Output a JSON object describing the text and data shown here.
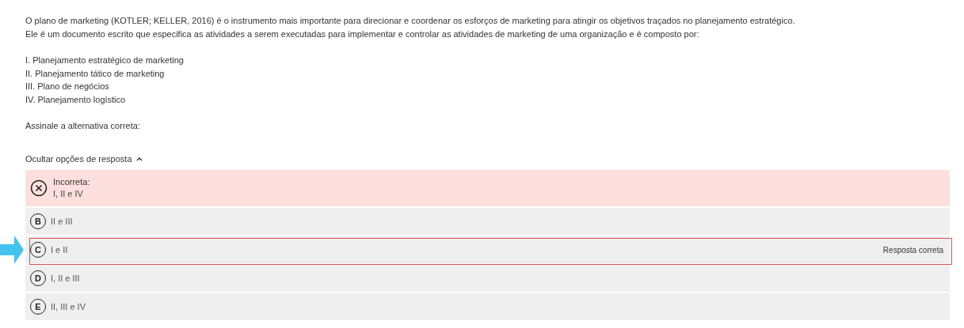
{
  "question": {
    "paragraphs": [
      "O plano de marketing (KOTLER; KELLER, 2016) é o instrumento mais importante para direcionar e coordenar os esforços de marketing para atingir os objetivos traçados no planejamento estratégico.",
      "Ele é um documento escrito que especifica as atividades a serem executadas para implementar e controlar as atividades de marketing de uma organização e é composto por:"
    ],
    "items": [
      "I. Planejamento estratégico de marketing",
      "II. Planejamento tático de marketing",
      "III. Plano de negócios",
      "IV. Planejamento logístico"
    ],
    "instruction": "Assinale a alternativa correta:"
  },
  "toggle": {
    "label": "Ocultar opções de resposta",
    "expanded": true
  },
  "options": [
    {
      "kind": "incorrect",
      "status_label": "Incorreta:",
      "text": "I, II e IV",
      "pointed": false
    },
    {
      "kind": "letter",
      "letter": "B",
      "text": "II e III",
      "pointed": false
    },
    {
      "kind": "letter",
      "letter": "C",
      "text": "I e II",
      "pointed": true,
      "note": "Resposta correta"
    },
    {
      "kind": "letter",
      "letter": "D",
      "text": "I, II e III",
      "pointed": false
    },
    {
      "kind": "letter",
      "letter": "E",
      "text": "II, III e IV",
      "pointed": false
    }
  ]
}
